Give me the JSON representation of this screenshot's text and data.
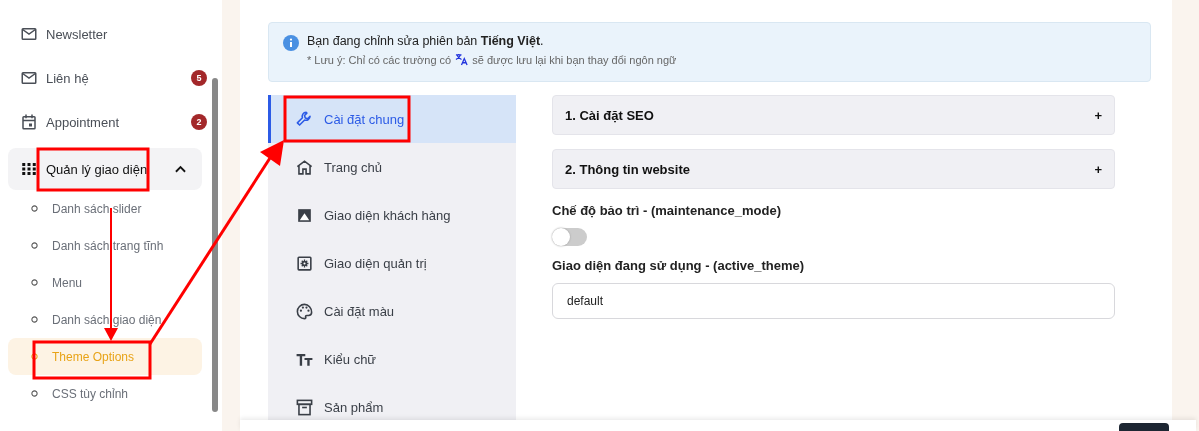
{
  "sidebar": {
    "items": [
      {
        "kind": "link",
        "label": "Newsletter"
      },
      {
        "kind": "link",
        "label": "Liên hệ",
        "badge": "5"
      },
      {
        "kind": "link",
        "label": "Appointment",
        "badge": "2"
      },
      {
        "kind": "group",
        "label": "Quản lý giao diện",
        "expanded": true,
        "children": [
          {
            "label": "Danh sách slider",
            "selected": false
          },
          {
            "label": "Danh sách trang tĩnh",
            "selected": false
          },
          {
            "label": "Menu",
            "selected": false
          },
          {
            "label": "Danh sách giao diện",
            "selected": false
          },
          {
            "label": "Theme Options",
            "selected": true
          },
          {
            "label": "CSS tùy chỉnh",
            "selected": false
          }
        ]
      }
    ]
  },
  "notice": {
    "title": "Bạn đang chỉnh sửa phiên bản **Tiếng Việt**.",
    "note_before": "* Lưu ý: Chỉ có các trường có",
    "note_after": "sẽ được lưu lại khi bạn thay đổi ngôn ngữ"
  },
  "tabs": [
    {
      "label": "Cài đặt chung",
      "selected": true
    },
    {
      "label": "Trang chủ",
      "selected": false
    },
    {
      "label": "Giao diện khách hàng",
      "selected": false
    },
    {
      "label": "Giao diện quản trị",
      "selected": false
    },
    {
      "label": "Cài đặt màu",
      "selected": false
    },
    {
      "label": "Kiểu chữ",
      "selected": false
    },
    {
      "label": "Sản phẩm",
      "selected": false
    }
  ],
  "sections": [
    {
      "kind": "accordion",
      "title": "1. Cài đặt SEO",
      "toggle": "+"
    },
    {
      "kind": "accordion",
      "title": "2. Thông tin website",
      "toggle": "+"
    },
    {
      "kind": "switch",
      "label": "Chế độ bảo trì - (maintenance_mode)",
      "on": false
    },
    {
      "kind": "input",
      "label": "Giao diện đang sử dụng - (active_theme)",
      "value": "default"
    }
  ]
}
